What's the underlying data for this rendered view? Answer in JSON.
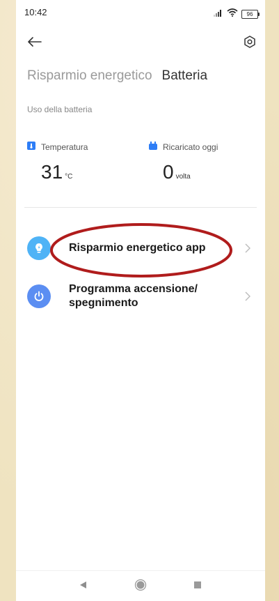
{
  "status_bar": {
    "time": "10:42",
    "battery_level": "96"
  },
  "icons": {
    "back": "arrow-left-icon",
    "settings": "gear-icon",
    "signal": "signal-icon",
    "wifi": "wifi-icon",
    "battery": "battery-icon",
    "temperature": "thermometer-icon",
    "charge": "plug-icon",
    "power_saving": "lightbulb-icon",
    "power_schedule": "power-icon",
    "chevron": "chevron-right-icon"
  },
  "tabs": [
    {
      "label": "Risparmio energetico",
      "active": false
    },
    {
      "label": "Batteria",
      "active": true
    }
  ],
  "section": {
    "label": "Uso della batteria"
  },
  "stats": {
    "temperature": {
      "label": "Temperatura",
      "value": "31",
      "unit": "°C"
    },
    "recharged": {
      "label": "Ricaricato oggi",
      "value": "0",
      "unit": "volta"
    }
  },
  "menu": {
    "items": [
      {
        "label": "Risparmio energetico app"
      },
      {
        "label_line1": "Programma accensione/",
        "label_line2": "spegnimento"
      }
    ]
  },
  "colors": {
    "blue_accent": "#2d7df6",
    "lightbulb_bg": "#4fb3f6",
    "power_bg": "#5b8ef2",
    "highlight_ring": "#b01c1c"
  }
}
